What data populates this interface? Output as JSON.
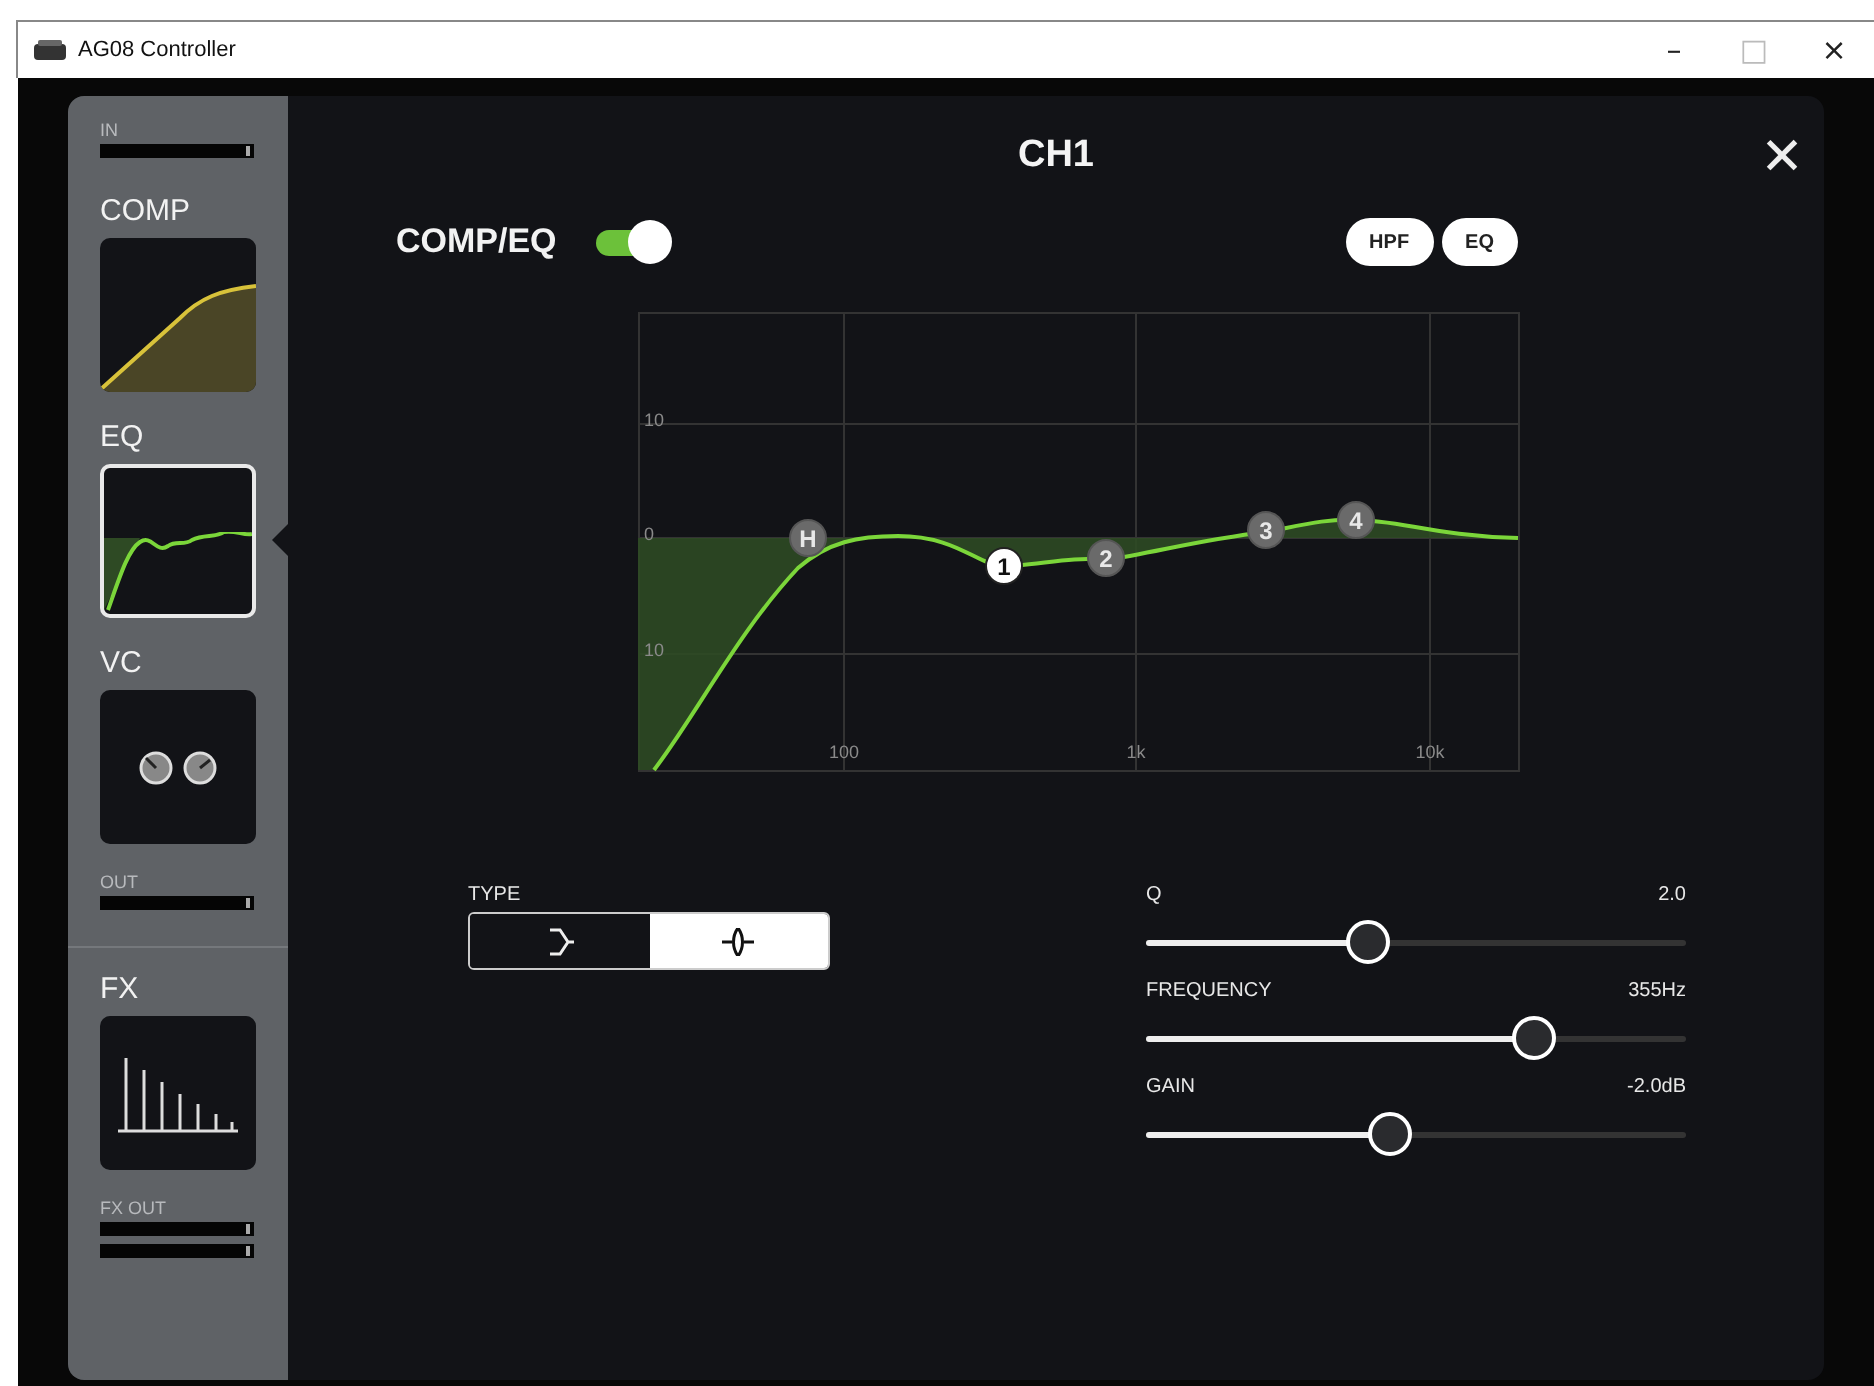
{
  "window": {
    "title": "AG08 Controller",
    "controls": [
      {
        "glyph": "–",
        "disabled": false
      },
      {
        "glyph": "□",
        "disabled": true
      },
      {
        "glyph": "×",
        "disabled": false
      }
    ]
  },
  "sidebar": {
    "items": [
      {
        "kind": "meter",
        "label": "IN"
      },
      {
        "kind": "comp",
        "label": "COMP",
        "selected": false
      },
      {
        "kind": "eq",
        "label": "EQ",
        "selected": true
      },
      {
        "kind": "vc",
        "label": "VC",
        "selected": false
      },
      {
        "kind": "meter",
        "label": "OUT"
      },
      {
        "kind": "fx",
        "label": "FX",
        "selected": false
      },
      {
        "kind": "stereo-meter",
        "label": "FX OUT"
      }
    ]
  },
  "panel": {
    "title": "CH1",
    "close": "✕"
  },
  "comp_eq": {
    "label": "COMP/EQ",
    "on": true
  },
  "mode_buttons": [
    {
      "label": "HPF"
    },
    {
      "label": "EQ"
    }
  ],
  "graph": {
    "y_labels": [
      "10",
      "0",
      "10"
    ],
    "x_labels": [
      "100",
      "1k",
      "10k"
    ],
    "bands": [
      {
        "label": "H",
        "selected": false
      },
      {
        "label": "1",
        "selected": true
      },
      {
        "label": "2",
        "selected": false
      },
      {
        "label": "3",
        "selected": false
      },
      {
        "label": "4",
        "selected": false
      }
    ]
  },
  "type": {
    "label": "TYPE",
    "options": [
      {
        "kind": "shelf",
        "selected": false
      },
      {
        "kind": "peak",
        "selected": true
      }
    ]
  },
  "sliders": [
    {
      "label": "Q",
      "reading": "2.0",
      "level": 0.41
    },
    {
      "label": "FREQUENCY",
      "reading": "355Hz",
      "level": 0.72
    },
    {
      "label": "GAIN",
      "reading": "-2.0dB",
      "level": 0.45
    }
  ]
}
